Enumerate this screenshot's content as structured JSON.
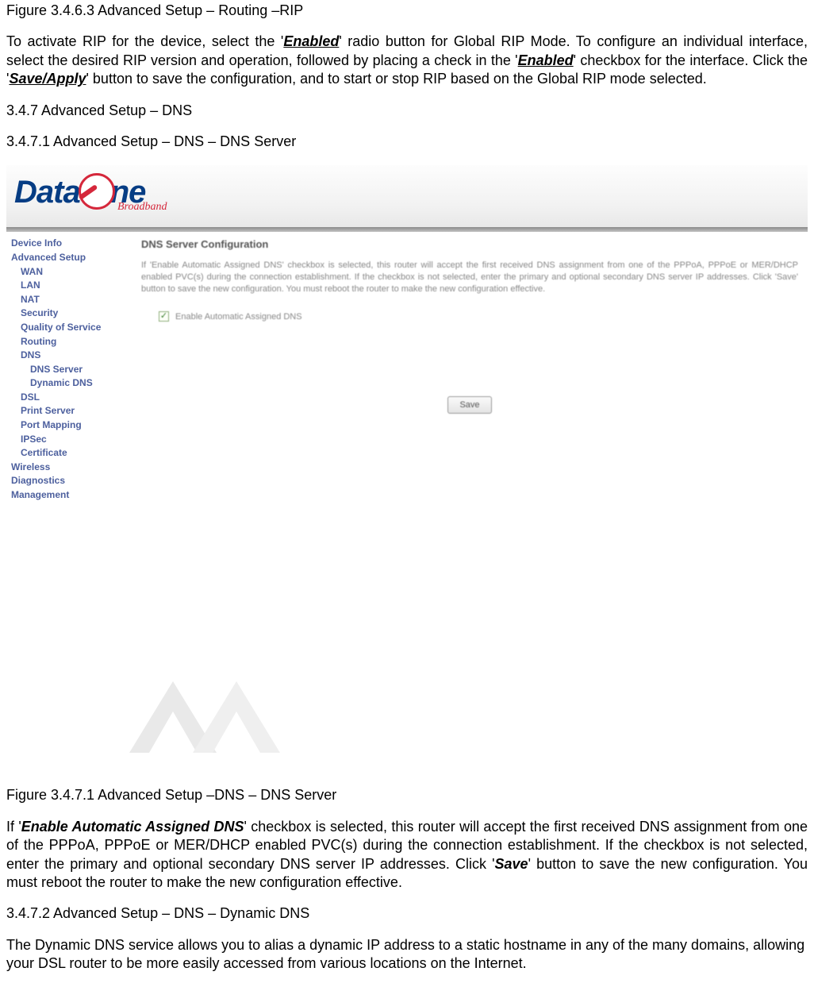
{
  "doc": {
    "top_caption": "Figure 3.4.6.3 Advanced Setup – Routing –RIP",
    "para1_a": "To activate RIP for the device, select the '",
    "para1_b": "Enabled",
    "para1_c": "' radio button for Global RIP Mode. To configure an individual interface, select the desired RIP version and operation, followed by placing a check in the '",
    "para1_d": "Enabled",
    "para1_e": "' checkbox for the interface. Click the '",
    "para1_f": "Save/Apply",
    "para1_g": "' button to save the configuration, and to start or stop RIP based on the Global RIP mode selected.",
    "heading_347": "3.4.7 Advanced Setup – DNS",
    "heading_3471": "3.4.7.1 Advanced Setup – DNS – DNS Server",
    "caption_3471": "Figure 3.4.7.1 Advanced Setup –DNS – DNS Server",
    "para2_a": "If '",
    "para2_b": "Enable Automatic Assigned DNS",
    "para2_c": "' checkbox is selected, this router will accept the first received DNS assignment from one of the PPPoA, PPPoE or MER/DHCP enabled PVC(s) during the connection establishment. If the checkbox is not selected, enter the primary and optional secondary DNS server IP addresses. Click '",
    "para2_d": "Save",
    "para2_e": "' button to save the new configuration. You must reboot the router to make the new configuration effective.",
    "heading_3472": "3.4.7.2 Advanced Setup – DNS – Dynamic DNS",
    "para3": "The Dynamic DNS service allows you to alias a dynamic IP address to a static hostname in any of the many domains, allowing your DSL router to be more easily accessed from various locations on the Internet."
  },
  "router": {
    "logo_a": "Data",
    "logo_b": "ne",
    "logo_sub": "Broadband",
    "sidebar": {
      "0": "Device Info",
      "1": "Advanced Setup",
      "2": "WAN",
      "3": "LAN",
      "4": "NAT",
      "5": "Security",
      "6": "Quality of Service",
      "7": "Routing",
      "8": "DNS",
      "9": "DNS Server",
      "10": "Dynamic DNS",
      "11": "DSL",
      "12": "Print Server",
      "13": "Port Mapping",
      "14": "IPSec",
      "15": "Certificate",
      "16": "Wireless",
      "17": "Diagnostics",
      "18": "Management"
    },
    "panel": {
      "title": "DNS Server Configuration",
      "desc": "If 'Enable Automatic Assigned DNS' checkbox is selected, this router will accept the first received DNS assignment from one of the PPPoA, PPPoE or MER/DHCP enabled PVC(s) during the connection establishment. If the checkbox is not selected, enter the primary and optional secondary DNS server IP addresses. Click 'Save' button to save the new configuration. You must reboot the router to make the new configuration effective.",
      "checkbox_label": "Enable Automatic Assigned DNS",
      "save_label": "Save"
    }
  }
}
